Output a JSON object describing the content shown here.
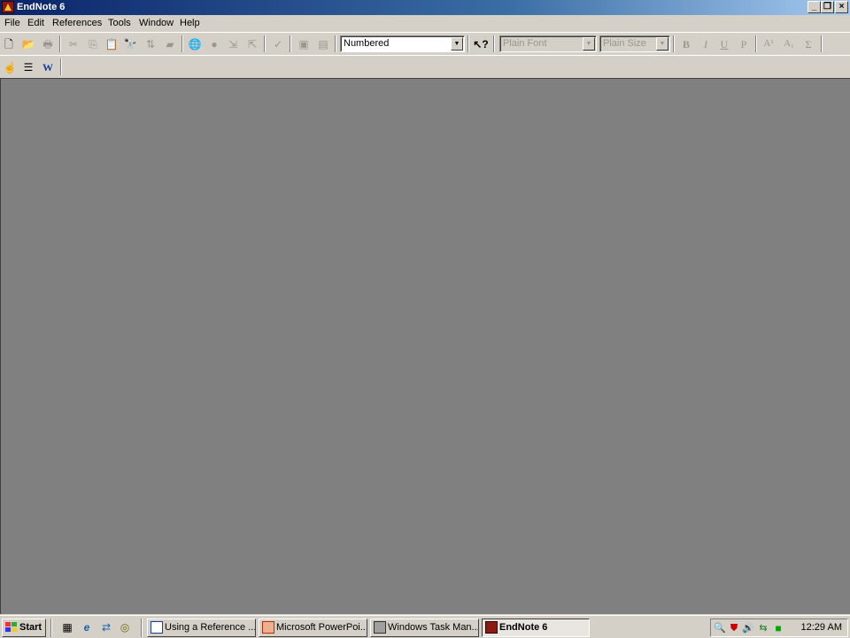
{
  "window": {
    "title": "EndNote 6",
    "icon": "endnote-app-icon",
    "controls": [
      "minimize-icon",
      "restore-icon",
      "close-icon"
    ]
  },
  "menu": [
    "File",
    "Edit",
    "References",
    "Tools",
    "Window",
    "Help"
  ],
  "toolbar1": {
    "buttons": [
      {
        "name": "new-icon",
        "glyph": "🗋"
      },
      {
        "name": "open-icon",
        "glyph": "📂"
      },
      {
        "name": "print-icon",
        "glyph": "🖶"
      },
      {
        "name": "cut-icon",
        "glyph": "✂"
      },
      {
        "name": "copy-icon",
        "glyph": "⎘"
      },
      {
        "name": "paste-icon",
        "glyph": "📋"
      },
      {
        "name": "find-icon",
        "glyph": "🔭"
      },
      {
        "name": "sort-icon",
        "glyph": "⇅"
      },
      {
        "name": "library-icon",
        "glyph": "▰"
      },
      {
        "name": "connect-icon",
        "glyph": "🌐"
      },
      {
        "name": "online-search-icon",
        "glyph": "●"
      },
      {
        "name": "import-icon",
        "glyph": "⇲"
      },
      {
        "name": "export-icon",
        "glyph": "⇱"
      },
      {
        "name": "spellcheck-icon",
        "glyph": "✓"
      },
      {
        "name": "insert-picture-icon",
        "glyph": "▣"
      },
      {
        "name": "insert-object-icon",
        "glyph": "▤"
      }
    ],
    "style_select": "Numbered",
    "help_icon": "context-help-icon",
    "font_select": "Plain Font",
    "size_select": "Plain Size",
    "format_buttons": [
      {
        "name": "bold-icon",
        "glyph": "B"
      },
      {
        "name": "italic-icon",
        "glyph": "I"
      },
      {
        "name": "underline-icon",
        "glyph": "U"
      },
      {
        "name": "plain-icon",
        "glyph": "P"
      },
      {
        "name": "superscript-icon",
        "glyph": "A¹"
      },
      {
        "name": "subscript-icon",
        "glyph": "A₁"
      },
      {
        "name": "symbol-icon",
        "glyph": "Σ"
      }
    ]
  },
  "toolbar2": {
    "buttons": [
      {
        "name": "insert-citation-icon",
        "glyph": "☝"
      },
      {
        "name": "format-bibliography-icon",
        "glyph": "☰"
      },
      {
        "name": "word-link-icon",
        "glyph": "W"
      }
    ]
  },
  "taskbar": {
    "start": "Start",
    "quick_launch": [
      {
        "name": "show-desktop-icon",
        "glyph": "▦"
      },
      {
        "name": "internet-explorer-icon",
        "glyph": "e"
      },
      {
        "name": "network-icon",
        "glyph": "⇄"
      },
      {
        "name": "media-icon",
        "glyph": "◎"
      }
    ],
    "tasks": [
      {
        "label": "Using a Reference ...",
        "icon": "word-doc-icon",
        "active": false
      },
      {
        "label": "Microsoft PowerPoi...",
        "icon": "powerpoint-icon",
        "active": false
      },
      {
        "label": "Windows Task Man...",
        "icon": "task-manager-icon",
        "active": false
      },
      {
        "label": "EndNote 6",
        "icon": "endnote-task-icon",
        "active": true
      }
    ],
    "tray_icons": [
      "magnifier-icon",
      "shield-icon",
      "volume-icon",
      "network-tray-icon",
      "status-icon"
    ],
    "clock": "12:29 AM"
  },
  "colors": {
    "workspace": "#808080",
    "chrome": "#d4d0c8",
    "title_gradient_start": "#0a246a",
    "title_gradient_end": "#a6caf0"
  }
}
